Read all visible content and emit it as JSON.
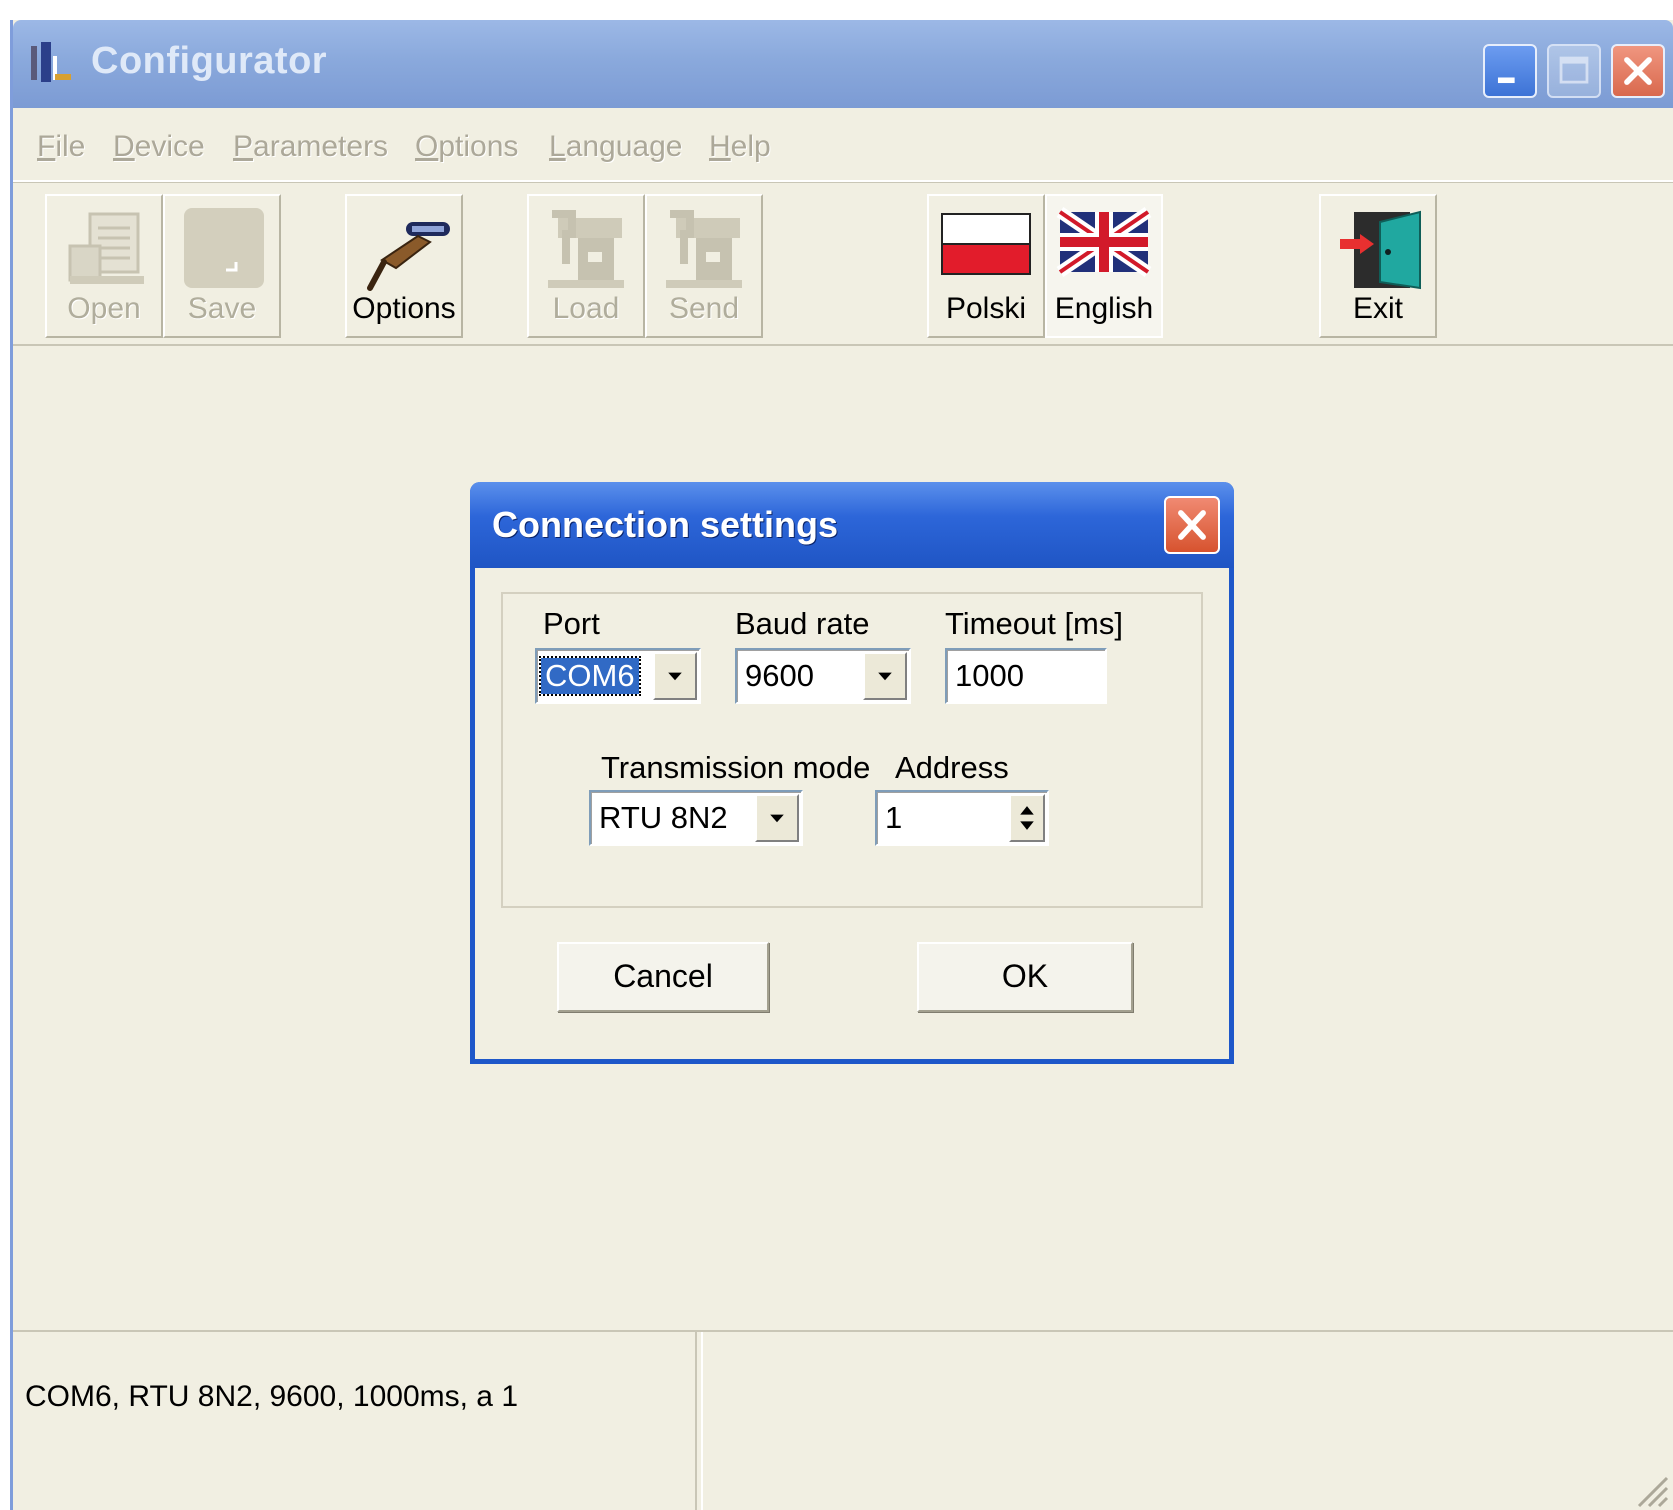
{
  "window": {
    "title": "Configurator",
    "controls": [
      "minimize-icon",
      "maximize-icon",
      "close-icon"
    ]
  },
  "menu": {
    "items": [
      {
        "label": "File",
        "enabled": false
      },
      {
        "label": "Device",
        "enabled": false
      },
      {
        "label": "Parameters",
        "enabled": false
      },
      {
        "label": "Options",
        "enabled": false
      },
      {
        "label": "Language",
        "enabled": false
      },
      {
        "label": "Help",
        "enabled": false
      }
    ]
  },
  "toolbar": {
    "open": {
      "label": "Open",
      "icon": "open-document-icon",
      "enabled": false
    },
    "save": {
      "label": "Save",
      "icon": "save-icon",
      "enabled": false
    },
    "options": {
      "label": "Options",
      "icon": "serial-cable-icon",
      "enabled": true
    },
    "load": {
      "label": "Load",
      "icon": "device-load-icon",
      "enabled": false
    },
    "send": {
      "label": "Send",
      "icon": "device-send-icon",
      "enabled": false
    },
    "polski": {
      "label": "Polski",
      "icon": "polish-flag-icon",
      "enabled": true
    },
    "english": {
      "label": "English",
      "icon": "uk-flag-icon",
      "enabled": true,
      "selected": true
    },
    "exit": {
      "label": "Exit",
      "icon": "exit-door-icon",
      "enabled": true
    }
  },
  "dialog": {
    "title": "Connection settings",
    "port": {
      "label": "Port",
      "value": "COM6"
    },
    "baud_rate": {
      "label": "Baud rate",
      "value": "9600"
    },
    "timeout": {
      "label": "Timeout [ms]",
      "value": "1000"
    },
    "transmission_mode": {
      "label": "Transmission mode",
      "value": "RTU 8N2"
    },
    "address": {
      "label": "Address",
      "value": "1"
    },
    "cancel_label": "Cancel",
    "ok_label": "OK"
  },
  "statusbar": {
    "pane1": "COM6, RTU 8N2, 9600, 1000ms, a 1",
    "pane2": ""
  },
  "colors": {
    "titlebar_inactive": "#8aa9dc",
    "dialog_title": "#2d66d9",
    "face": "#f1efe2",
    "selection": "#316ac5"
  }
}
